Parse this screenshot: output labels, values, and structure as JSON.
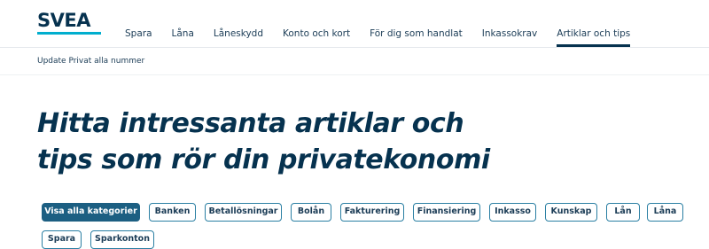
{
  "header": {
    "logo_text": "SVEA",
    "nav": [
      {
        "label": "Spara"
      },
      {
        "label": "Låna"
      },
      {
        "label": "Låneskydd"
      },
      {
        "label": "Konto och kort"
      },
      {
        "label": "För dig som handlat"
      },
      {
        "label": "Inkassokrav"
      },
      {
        "label": "Artiklar och tips",
        "active": true
      }
    ]
  },
  "subnav": {
    "link": "Update Privat alla nummer"
  },
  "main": {
    "title_line1": "Hitta intressanta artiklar och",
    "title_line2": "tips som rör din privatekonomi"
  },
  "categories": [
    {
      "label": "Visa alla kategorier",
      "active": true
    },
    {
      "label": "Banken"
    },
    {
      "label": "Betallösningar"
    },
    {
      "label": "Bolån"
    },
    {
      "label": "Fakturering"
    },
    {
      "label": "Finansiering"
    },
    {
      "label": "Inkasso"
    },
    {
      "label": "Kunskap"
    },
    {
      "label": "Lån"
    },
    {
      "label": "Låna"
    },
    {
      "label": "Spara"
    },
    {
      "label": "Sparkonton"
    }
  ],
  "colors": {
    "brand": "#06324f",
    "accent": "#00aece",
    "chip_active": "#1c5f82"
  }
}
